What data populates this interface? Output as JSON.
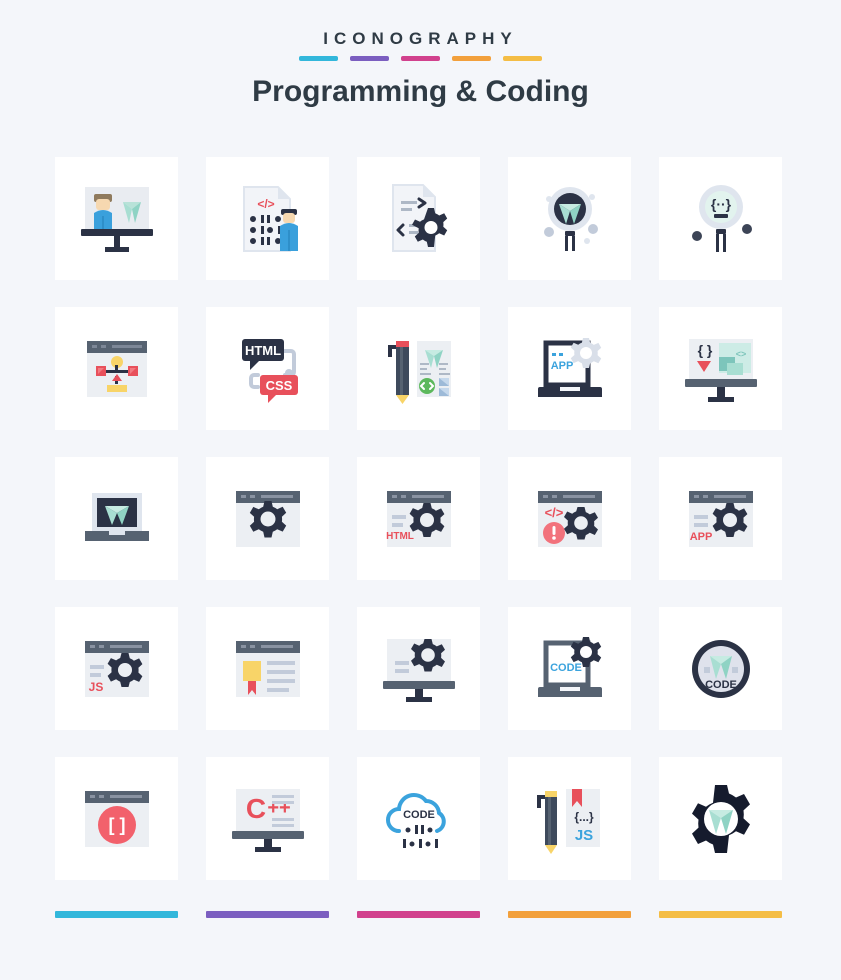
{
  "header": {
    "eyebrow": "ICONOGRAPHY",
    "title": "Programming & Coding",
    "swatches": [
      {
        "name": "cyan",
        "color": "#32b7db"
      },
      {
        "name": "purple",
        "color": "#7b5ec0"
      },
      {
        "name": "pink",
        "color": "#d1418d"
      },
      {
        "name": "orange",
        "color": "#f2a03c"
      },
      {
        "name": "gold",
        "color": "#f4bd45"
      }
    ]
  },
  "footer": {
    "bars": [
      {
        "name": "cyan",
        "color": "#32b7db"
      },
      {
        "name": "purple",
        "color": "#7b5ec0"
      },
      {
        "name": "pink",
        "color": "#d1418d"
      },
      {
        "name": "orange",
        "color": "#f2a03c"
      },
      {
        "name": "gold",
        "color": "#f4bd45"
      }
    ]
  },
  "palette": {
    "background": "#f4f6fa",
    "card": "#ffffff",
    "dark_navy": "#2b3245",
    "slate": "#566271",
    "light_grey": "#e9ecf1",
    "pale_blue": "#dfe5ee",
    "red": "#e8505b",
    "skin": "#f6d8b0",
    "shirt_blue": "#3aa0dc",
    "diamond": "#a8ded2",
    "green": "#5cb85c",
    "yellow": "#f8d468",
    "code_blue": "#3ba3dd"
  },
  "grid": {
    "columns": 5,
    "rows": 5,
    "icons": [
      {
        "id": "presentation-diamond",
        "label": "Presenter at board with diamond",
        "row": 1,
        "col": 1,
        "text": ""
      },
      {
        "id": "code-document-developer",
        "label": "Code document with developer",
        "row": 1,
        "col": 2,
        "text": "</>"
      },
      {
        "id": "document-gear",
        "label": "Code document with gear",
        "row": 1,
        "col": 3,
        "text": ""
      },
      {
        "id": "magnifier-diamond",
        "label": "Magnifier inspecting diamond",
        "row": 1,
        "col": 4,
        "text": ""
      },
      {
        "id": "magnifier-code-face",
        "label": "Magnifier with code face",
        "row": 1,
        "col": 5,
        "text": "{..}"
      },
      {
        "id": "browser-flowchart",
        "label": "Browser window with flow diagram",
        "row": 2,
        "col": 1,
        "text": ""
      },
      {
        "id": "html-css-bubbles",
        "label": "HTML and CSS speech bubbles",
        "row": 2,
        "col": 2,
        "text": "HTML / CSS"
      },
      {
        "id": "pen-design-document",
        "label": "Pen with design document",
        "row": 2,
        "col": 3,
        "text": ""
      },
      {
        "id": "laptop-app-gear",
        "label": "Laptop app development with gear",
        "row": 2,
        "col": 4,
        "text": "APP"
      },
      {
        "id": "monitor-code-brackets",
        "label": "Monitor with code brackets",
        "row": 2,
        "col": 5,
        "text": "{ } < >"
      },
      {
        "id": "laptop-diamond",
        "label": "Laptop with diamond",
        "row": 3,
        "col": 1,
        "text": ""
      },
      {
        "id": "browser-gear",
        "label": "Browser window with gear",
        "row": 3,
        "col": 2,
        "text": ""
      },
      {
        "id": "browser-html-gear",
        "label": "Browser HTML settings",
        "row": 3,
        "col": 3,
        "text": "HTML"
      },
      {
        "id": "browser-code-error-gear",
        "label": "Browser code error with gear",
        "row": 3,
        "col": 4,
        "text": "</>"
      },
      {
        "id": "browser-app-gear",
        "label": "Browser app settings",
        "row": 3,
        "col": 5,
        "text": "APP"
      },
      {
        "id": "browser-js-gear",
        "label": "Browser JavaScript settings",
        "row": 4,
        "col": 1,
        "text": "JS"
      },
      {
        "id": "browser-certificate",
        "label": "Browser with certificate badge",
        "row": 4,
        "col": 2,
        "text": ""
      },
      {
        "id": "monitor-gear",
        "label": "Monitor with gear",
        "row": 4,
        "col": 3,
        "text": ""
      },
      {
        "id": "laptop-code-gear",
        "label": "Laptop code with gear",
        "row": 4,
        "col": 4,
        "text": "CODE"
      },
      {
        "id": "badge-diamond-code",
        "label": "Round badge with diamond and code",
        "row": 4,
        "col": 5,
        "text": "CODE"
      },
      {
        "id": "browser-brackets-circle",
        "label": "Browser with bracket circle",
        "row": 5,
        "col": 1,
        "text": "[ ]"
      },
      {
        "id": "monitor-cpp",
        "label": "Monitor showing C++",
        "row": 5,
        "col": 2,
        "text": "C++"
      },
      {
        "id": "cloud-code",
        "label": "Cloud computing code",
        "row": 5,
        "col": 3,
        "text": "CODE"
      },
      {
        "id": "pen-js-document",
        "label": "Pen with JavaScript document",
        "row": 5,
        "col": 4,
        "text": "{...} JS"
      },
      {
        "id": "gear-diamond",
        "label": "Gear with diamond",
        "row": 5,
        "col": 5,
        "text": ""
      }
    ]
  }
}
